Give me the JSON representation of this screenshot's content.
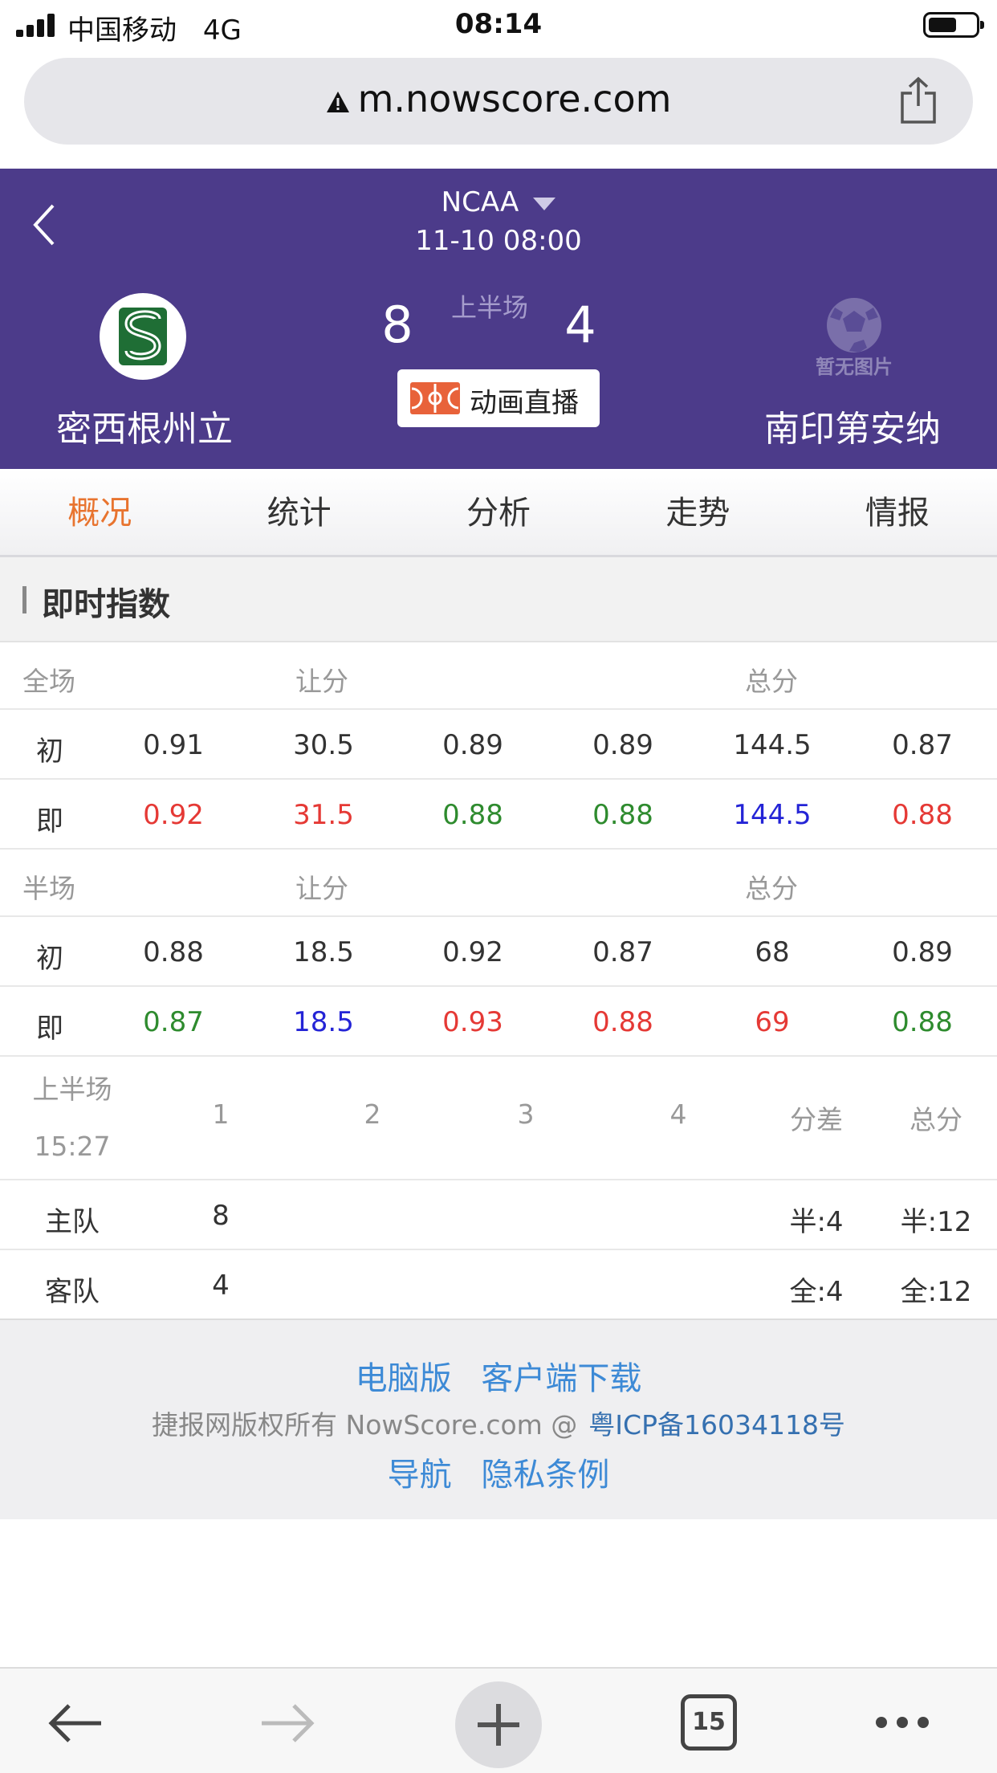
{
  "status_bar": {
    "carrier": "中国移动",
    "network": "4G",
    "time": "08:14"
  },
  "browser": {
    "url": "m.nowscore.com",
    "tab_count": "15"
  },
  "match": {
    "league": "NCAA",
    "datetime": "11-10 08:00",
    "home_team": "密西根州立",
    "away_team": "南印第安纳",
    "home_score": "8",
    "away_score": "4",
    "period": "上半场",
    "live_button": "动画直播",
    "away_logo_text": "暂无图片"
  },
  "tabs": [
    {
      "label": "概况",
      "active": true
    },
    {
      "label": "统计",
      "active": false
    },
    {
      "label": "分析",
      "active": false
    },
    {
      "label": "走势",
      "active": false
    },
    {
      "label": "情报",
      "active": false
    }
  ],
  "section_title": "即时指数",
  "odds": {
    "full": {
      "label": "全场",
      "handicap_label": "让分",
      "total_label": "总分",
      "initial": {
        "label": "初",
        "values": [
          "0.91",
          "30.5",
          "0.89",
          "0.89",
          "144.5",
          "0.87"
        ]
      },
      "live": {
        "label": "即",
        "values": [
          "0.92",
          "31.5",
          "0.88",
          "0.88",
          "144.5",
          "0.88"
        ],
        "colors": [
          "#e53935",
          "#e53935",
          "#2e8b2e",
          "#2e8b2e",
          "#2424d6",
          "#e53935"
        ]
      }
    },
    "half": {
      "label": "半场",
      "handicap_label": "让分",
      "total_label": "总分",
      "initial": {
        "label": "初",
        "values": [
          "0.88",
          "18.5",
          "0.92",
          "0.87",
          "68",
          "0.89"
        ]
      },
      "live": {
        "label": "即",
        "values": [
          "0.87",
          "18.5",
          "0.93",
          "0.88",
          "69",
          "0.88"
        ],
        "colors": [
          "#2e8b2e",
          "#2424d6",
          "#e53935",
          "#e53935",
          "#e53935",
          "#2e8b2e"
        ]
      }
    }
  },
  "quarters": {
    "period": "上半场",
    "clock": "15:27",
    "headers": [
      "1",
      "2",
      "3",
      "4",
      "分差",
      "总分"
    ],
    "home": {
      "label": "主队",
      "q1": "8",
      "diff": "半:4",
      "total": "半:12"
    },
    "away": {
      "label": "客队",
      "q1": "4",
      "diff": "全:4",
      "total": "全:12"
    }
  },
  "footer": {
    "desktop_link": "电脑版",
    "app_link": "客户端下载",
    "copyright": "捷报网版权所有 NowScore.com @",
    "icp": "粤ICP备16034118号",
    "nav_link": "导航",
    "privacy_link": "隐私条例"
  },
  "colors": {
    "header_bg": "#4c3b8a",
    "active_tab": "#e8742f",
    "link": "#3d8ad6"
  }
}
